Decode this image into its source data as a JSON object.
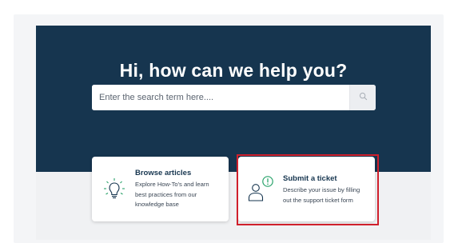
{
  "hero": {
    "title": "Hi, how can we help you?"
  },
  "search": {
    "placeholder": "Enter the search term here....",
    "value": ""
  },
  "cards": {
    "browse": {
      "title": "Browse articles",
      "desc_lines": [
        "Explore How-To's and learn",
        "best practices from our",
        "knowledge base"
      ],
      "icon": "lightbulb-icon"
    },
    "submit": {
      "title": "Submit a ticket",
      "desc_lines": [
        "Describe your issue by filling",
        "out the support ticket form"
      ],
      "icon": "person-alert-icon"
    }
  },
  "colors": {
    "hero_bg": "#16354f",
    "accent_green": "#2aa36b",
    "highlight_red": "#d0202c"
  }
}
